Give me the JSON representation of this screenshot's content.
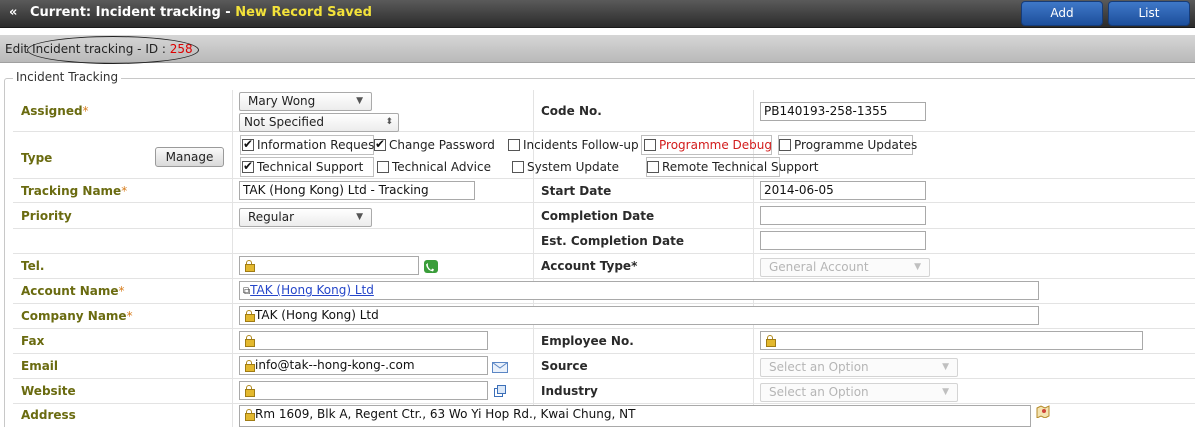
{
  "topbar": {
    "chevron": "«",
    "title": "Current: Incident tracking - ",
    "saved_status": "New Record Saved",
    "add_label": "Add",
    "list_label": "List"
  },
  "editbar": {
    "prefix": "Edit",
    "label": " Incident tracking - ID : ",
    "record_id": "258"
  },
  "section": {
    "legend": "Incident Tracking"
  },
  "form": {
    "assigned": {
      "label": "Assigned",
      "value": "Mary Wong",
      "second_value": "Not Specified"
    },
    "code_no": {
      "label": "Code No.",
      "value": "PB140193-258-1355"
    },
    "type": {
      "label": "Type",
      "manage_label": "Manage",
      "options": [
        {
          "label": "Information Request",
          "checked": true
        },
        {
          "label": "Change Password",
          "checked": true
        },
        {
          "label": "Incidents Follow-up",
          "checked": false
        },
        {
          "label": "Programme Debug",
          "checked": false
        },
        {
          "label": "Programme Updates",
          "checked": false
        },
        {
          "label": "Technical Support",
          "checked": true
        },
        {
          "label": "Technical Advice",
          "checked": false
        },
        {
          "label": "System Update",
          "checked": false
        },
        {
          "label": "Remote Technical Support",
          "checked": false
        }
      ]
    },
    "tracking_name": {
      "label": "Tracking Name",
      "value": "TAK (Hong Kong) Ltd - Tracking"
    },
    "start_date": {
      "label": "Start Date",
      "value": "2014-06-05"
    },
    "priority": {
      "label": "Priority",
      "value": "Regular"
    },
    "completion_date": {
      "label": "Completion Date",
      "value": ""
    },
    "est_completion_date": {
      "label": "Est. Completion Date",
      "value": ""
    },
    "tel": {
      "label": "Tel.",
      "value": ""
    },
    "account_type": {
      "label": "Account Type",
      "value": "General Account"
    },
    "account_name": {
      "label": "Account Name",
      "value": "TAK (Hong Kong) Ltd"
    },
    "company_name": {
      "label": "Company Name",
      "value": "TAK (Hong Kong) Ltd"
    },
    "fax": {
      "label": "Fax",
      "value": ""
    },
    "employee_no": {
      "label": "Employee No.",
      "value": ""
    },
    "email": {
      "label": "Email",
      "value": "info@tak--hong-kong-.com"
    },
    "source": {
      "label": "Source",
      "placeholder": "Select an Option"
    },
    "website": {
      "label": "Website",
      "value": ""
    },
    "industry": {
      "label": "Industry",
      "placeholder": "Select an Option"
    },
    "address": {
      "label": "Address",
      "value": "Rm 1609, Blk A, Regent Ctr., 63 Wo Yi Hop Rd., Kwai Chung, NT"
    },
    "required_mark": "*"
  },
  "colors": {
    "label_olive": "#6a6b10",
    "required": "#d77c1c",
    "saved_yellow": "#f3e23a",
    "id_red": "#dd0000",
    "debug_red": "#d21b1b",
    "link_blue": "#2546c9",
    "button_blue": "#2a62b4"
  },
  "icons": [
    "double-chevron-left-icon",
    "lock-icon",
    "phone-icon",
    "envelope-icon",
    "external-link-icon",
    "map-icon"
  ]
}
